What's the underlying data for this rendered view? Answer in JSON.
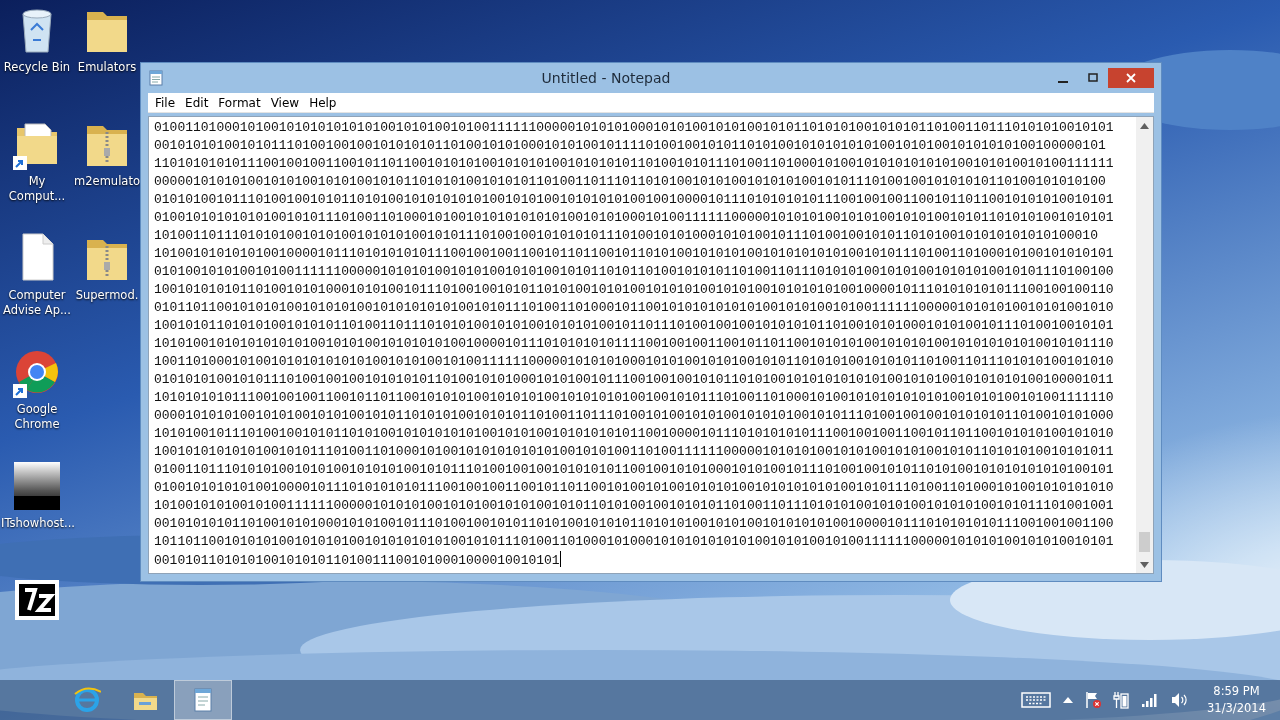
{
  "desktop": {
    "icons": [
      {
        "label": "Recycle Bin",
        "kind": "recycle-bin",
        "shortcut": false
      },
      {
        "label": "My Comput...",
        "kind": "folder-docs",
        "shortcut": true
      },
      {
        "label": "Computer Advise Ap...",
        "kind": "document",
        "shortcut": false
      },
      {
        "label": "Google Chrome",
        "kind": "browser",
        "shortcut": true
      },
      {
        "label": "ITshowhost...",
        "kind": "thumbnail",
        "shortcut": false
      },
      {
        "kind": "archive",
        "shortcut": false
      },
      {
        "label": "Emulators",
        "kind": "folder",
        "shortcut": false
      },
      {
        "label": "m2emulato",
        "kind": "zip-folder",
        "shortcut": false
      },
      {
        "label": "Supermod.",
        "kind": "zip-folder",
        "shortcut": false
      }
    ]
  },
  "window": {
    "title": "Untitled - Notepad",
    "menu": [
      "File",
      "Edit",
      "Format",
      "View",
      "Help"
    ],
    "lines": [
      "010011010001010010101010101010010101001010011111100000101010100010101001010100101011010101001010101101001101110101010010101",
      "00101010100101011101001001001010101011010010101000101010010111101001001010110101001010101010100101010010101010100100000101",
      "110101010101110010010011001011011001010101001010101001010101011010010101110100110100010100101010101010100101010010100111111",
      "00000101010100101010010101001010110101010010101011010011011101101010010101001010101001010111010010010101010110100101010100",
      "010101001011101001001010110101001010101010100101010010101010100100100001011101010101011100100100110010110110010101010010101",
      "010010101010101001010111010011010001010010101010101010010101000101001111110000010101010010101001010100101011010101001010101",
      "1010011011101010100101010010101010010101110100100101010101110100101010001010100101110100100101011010100101010101010100010",
      "101001010101010010000101110101010101110010010011001011011001011010100101010100101010101010010101110100110100010100101010101",
      "010100101010010100111111000001010101001010100101010010101101011010010101011010011011101010100101010010101010010101110100100",
      "100101010101101001010100010101001011101001001010110101001010100101010100101010010101010100100001011101010101011100100100110",
      "010110110010101010010101010010101010101001010111010011010001011001010101010101001010100101001111110000010101010010101001010",
      "100101011010101001010101101001101110101010010101001010101001011011101001001001010101011010010101000101010010111010010010101",
      "101010010101010101010010101001010101010010000101110101010101111001001001100101101100101010100101010100101010101010010101110",
      "100110100010100101010101010100101010010100111111000001010101000101010010101001010110101010010101011010011011101010100101010",
      "010101010010101110100100100101010101101001010100010101001011100100100101011010100101010101010100101010010101010100100001011",
      "101010101011100100100110010110110010101010010101010010101010100100101011101001101000101001010101010101001010100101001111110",
      "000010101010010101001010100101011010101001010101101001101110100101001010100101010100101011101001001001010101011010010101000",
      "101010010111010010010101101010010101010101001010100101010101011001000010111010101010111001001001100101101100101010100101010",
      "100101010101010010101110100110100010100101010101010100101010011010011111100000101010100101010010101001010110101010010101011",
      "010011011101010100101010010101010010101110100100100101010101100100101010001010100101110100100101011010100101010101010100101",
      "010010101010100100001011101010101011100100100110010110110010100101001010101001010101010100101011101001101000101001010101010",
      "101001010100101001111110000010101010010101001010100101011010100100101010110100110111010101001010100101010100101011101001001",
      "001010101011010010101000101010010111010010010101101010010101011010101001010100101010101001000010111010101010111001001001100",
      "101101100101010100101010100101010101010010101110100110100010100010101010101010010101001010011111100000101010100101010010101",
      "0010101101010100101010110100111001010001000010010101"
    ]
  },
  "taskbar": {
    "apps": [
      {
        "kind": "browser",
        "active": false
      },
      {
        "kind": "files",
        "active": false
      },
      {
        "kind": "notepad",
        "active": true
      }
    ],
    "clock": {
      "time": "8:59 PM",
      "date": "31/3/2014"
    }
  }
}
